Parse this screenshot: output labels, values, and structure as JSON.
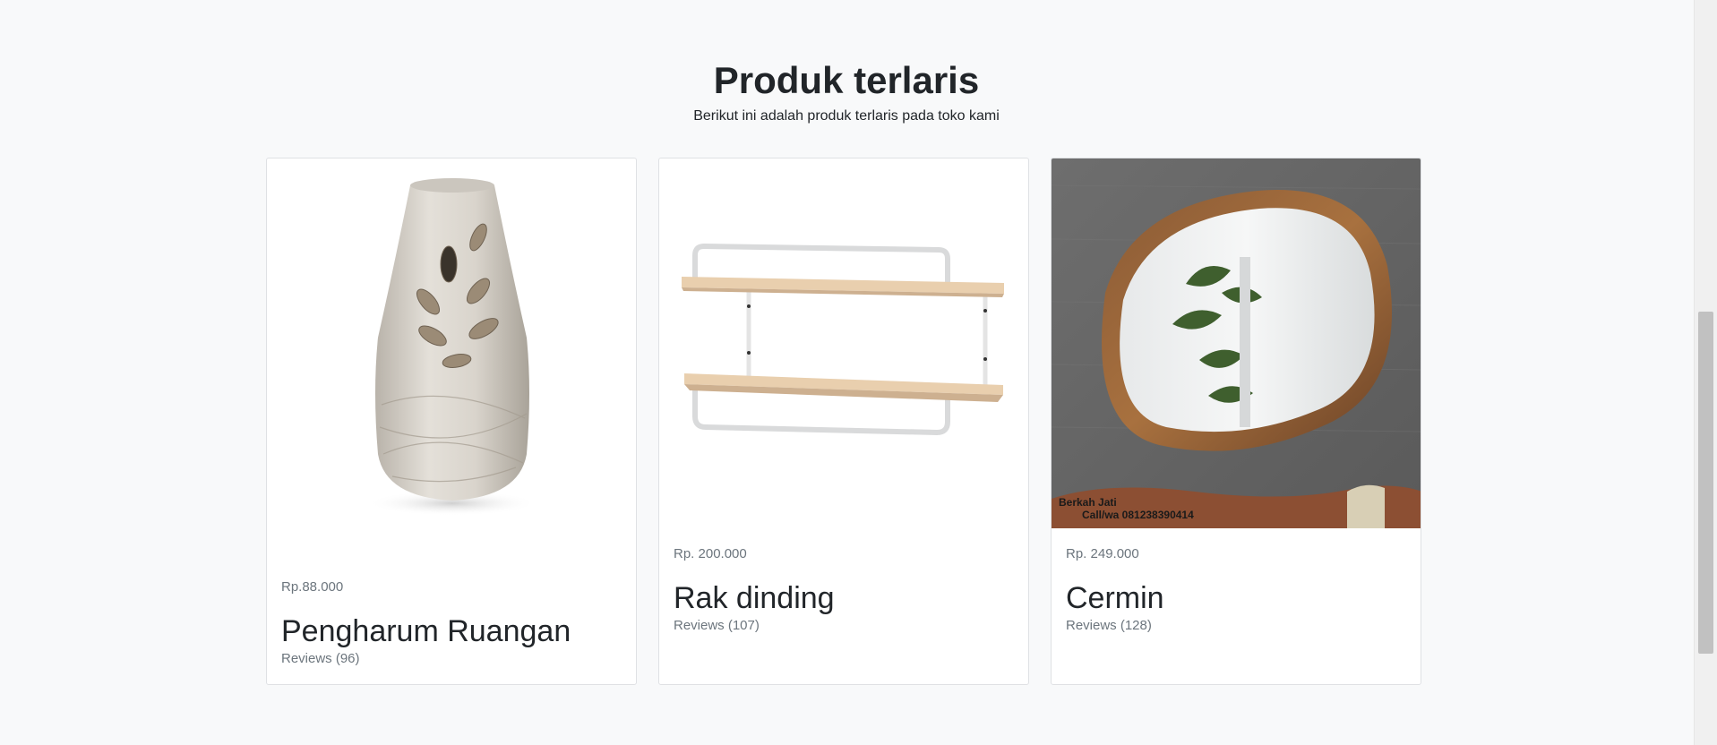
{
  "section": {
    "title": "Produk terlaris",
    "subtitle": "Berikut ini adalah produk terlaris pada toko kami"
  },
  "products": [
    {
      "price": "Rp.88.000",
      "name": "Pengharum Ruangan",
      "reviews": "Reviews (96)",
      "image_icon": "air-freshener-vase"
    },
    {
      "price": "Rp. 200.000",
      "name": "Rak dinding",
      "reviews": "Reviews (107)",
      "image_icon": "wall-shelf"
    },
    {
      "price": "Rp. 249.000",
      "name": "Cermin",
      "reviews": "Reviews (128)",
      "image_icon": "wooden-mirror",
      "image_watermark": [
        "Berkah Jati",
        "Call/wa 081238390414"
      ]
    }
  ],
  "colors": {
    "background": "#f8f9fa",
    "card_border": "#dfe1e4",
    "muted_text": "#6c757d",
    "heading_text": "#212529"
  }
}
